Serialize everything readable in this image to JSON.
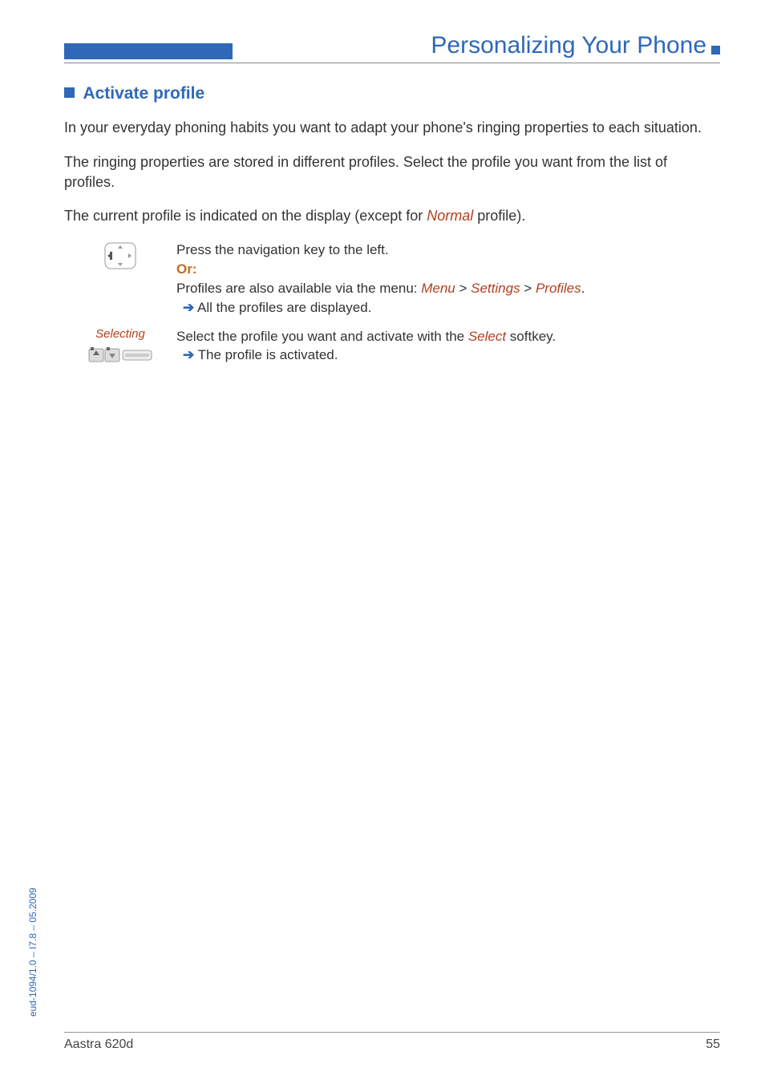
{
  "header": {
    "title": "Personalizing Your Phone"
  },
  "section": {
    "title": "Activate profile"
  },
  "paragraphs": {
    "p1": "In your everyday phoning habits you want to adapt your phone's ringing properties to each situation.",
    "p2": "The ringing properties are stored in different profiles. Select the profile you want from the list of profiles.",
    "p3a": "The current profile is indicated on the display (except for ",
    "p3ref": "Normal",
    "p3b": " profile)."
  },
  "step1": {
    "line1": "Press the navigation key to the left.",
    "or": "Or:",
    "line2a": "Profiles are also available via the menu: ",
    "menu": "Menu",
    "sep": " > ",
    "settings": "Settings",
    "profiles": "Profiles",
    "dot": ".",
    "line3": " All the profiles are displayed."
  },
  "step2": {
    "label": "Selecting",
    "line1a": "Select the profile you want and activate with the ",
    "selectRef": "Select",
    "line1b": " softkey.",
    "line2": " The profile is activated."
  },
  "footer": {
    "left": "Aastra 620d",
    "right": "55"
  },
  "side": "eud-1094/1.0 – I7.8 – 05.2009",
  "arrow": "➔"
}
